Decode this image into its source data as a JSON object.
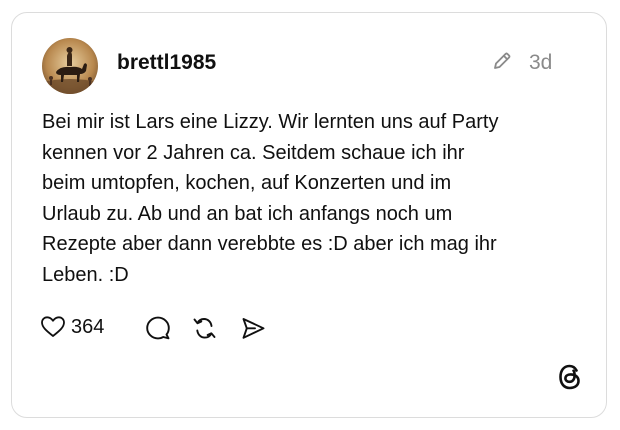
{
  "post": {
    "username": "brettl1985",
    "timestamp": "3d",
    "text_lines": [
      "Bei mir ist Lars eine Lizzy. Wir lernten uns auf Party",
      "kennen vor 2 Jahren ca. Seitdem schaue ich ihr",
      "beim umtopfen, kochen, auf Konzerten und im",
      "Urlaub zu. Ab und an bat ich anfangs noch um",
      "Rezepte aber dann verebbte es :D aber ich mag ihr",
      "Leben. :D"
    ],
    "likes": "364"
  },
  "icons": {
    "edit": "pencil-icon",
    "like": "heart-icon",
    "reply": "comment-bubble-icon",
    "repost": "repost-icon",
    "share": "send-icon",
    "brand": "threads-logo-icon"
  },
  "colors": {
    "text": "#101010",
    "muted": "#8a8a8a",
    "border": "#dcdcdc",
    "background": "#ffffff"
  }
}
